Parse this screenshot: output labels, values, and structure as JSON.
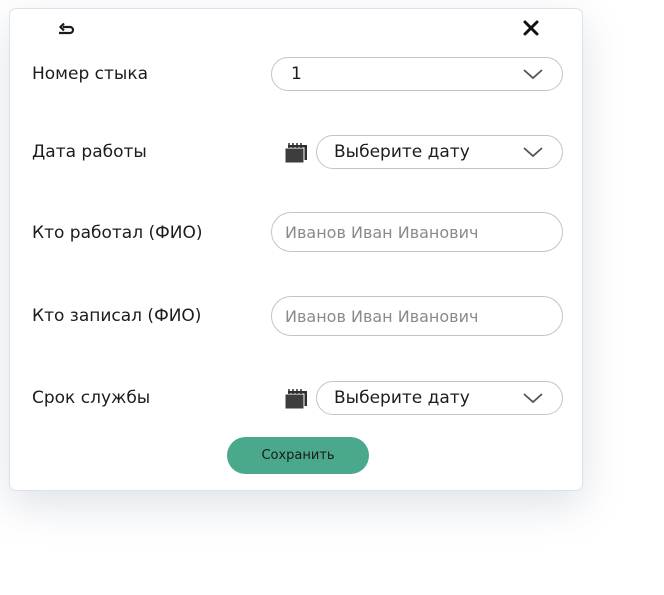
{
  "icons": {
    "back": "undo-arrow-icon",
    "close": "close-icon",
    "calendar": "calendar-icon",
    "chevron": "chevron-down-icon"
  },
  "form": {
    "joint_number": {
      "label": "Номер стыка",
      "value": "1"
    },
    "work_date": {
      "label": "Дата работы",
      "value": "Выберите дату"
    },
    "worked_by": {
      "label": "Кто работал (ФИО)",
      "value": "",
      "placeholder": "Иванов Иван Иванович"
    },
    "recorded_by": {
      "label": "Кто записал (ФИО)",
      "value": "",
      "placeholder": "Иванов Иван Иванович"
    },
    "service_life": {
      "label": "Срок службы",
      "value": "Выберите дату"
    }
  },
  "actions": {
    "save_label": "Сохранить"
  },
  "colors": {
    "accent": "#4aa88c",
    "border": "#c4c4c4",
    "text": "#1c1c1c",
    "placeholder": "#8a8a8a"
  }
}
